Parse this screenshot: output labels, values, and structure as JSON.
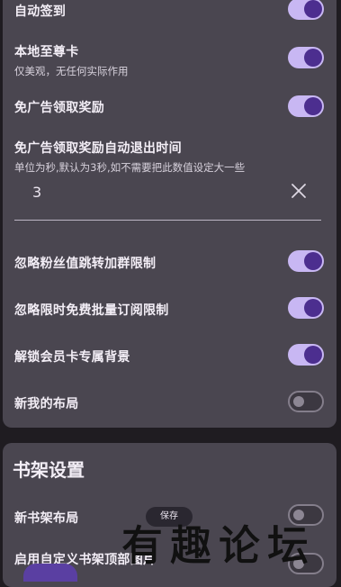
{
  "settings": {
    "items": [
      {
        "label": "自动签到",
        "on": true
      },
      {
        "label": "本地至尊卡",
        "sub": "仅美观，无任何实际作用",
        "on": true
      },
      {
        "label": "免广告领取奖励",
        "on": true
      },
      {
        "label": "免广告领取奖励自动退出时间",
        "sub": "单位为秒,默认为3秒,如不需要把此数值设定大一些"
      },
      {
        "label": "忽略粉丝值跳转加群限制",
        "on": true
      },
      {
        "label": "忽略限时免费批量订阅限制",
        "on": true
      },
      {
        "label": "解锁会员卡专属背景",
        "on": true
      },
      {
        "label": "新我的布局",
        "on": false
      }
    ],
    "timeout_value": "3"
  },
  "bookshelf": {
    "title": "书架设置",
    "items": [
      {
        "label": "新书架布局",
        "on": false
      },
      {
        "label": "启用自定义书架顶部图片",
        "on": false
      }
    ]
  },
  "toast": "保存",
  "watermark": "有趣论坛",
  "colors": {
    "accent": "#c8b7f3",
    "knob": "#4c2e8f",
    "card": "#4a4650",
    "background": "#1f1c21"
  }
}
